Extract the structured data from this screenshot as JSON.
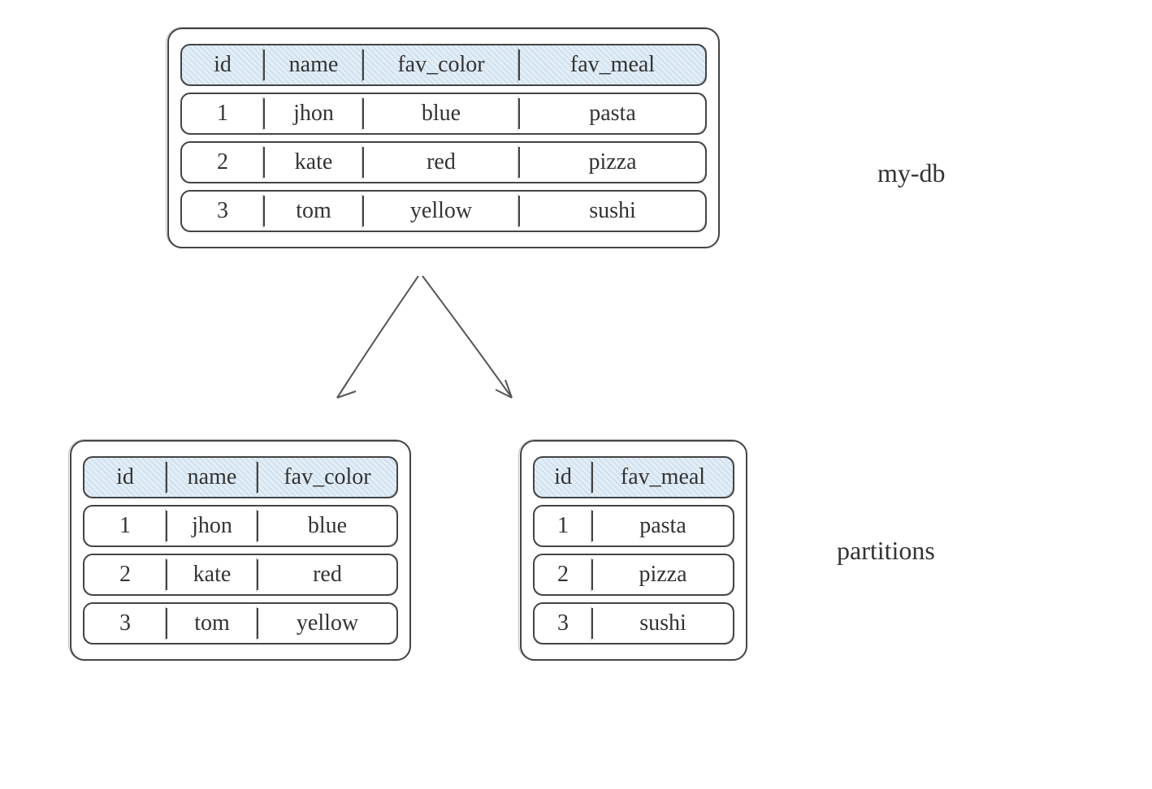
{
  "labels": {
    "db_name": "my-db",
    "partitions": "partitions"
  },
  "main_table": {
    "headers": [
      "id",
      "name",
      "fav_color",
      "fav_meal"
    ],
    "rows": [
      [
        "1",
        "jhon",
        "blue",
        "pasta"
      ],
      [
        "2",
        "kate",
        "red",
        "pizza"
      ],
      [
        "3",
        "tom",
        "yellow",
        "sushi"
      ]
    ]
  },
  "partition_left": {
    "headers": [
      "id",
      "name",
      "fav_color"
    ],
    "rows": [
      [
        "1",
        "jhon",
        "blue"
      ],
      [
        "2",
        "kate",
        "red"
      ],
      [
        "3",
        "tom",
        "yellow"
      ]
    ]
  },
  "partition_right": {
    "headers": [
      "id",
      "fav_meal"
    ],
    "rows": [
      [
        "1",
        "pasta"
      ],
      [
        "2",
        "pizza"
      ],
      [
        "3",
        "sushi"
      ]
    ]
  }
}
